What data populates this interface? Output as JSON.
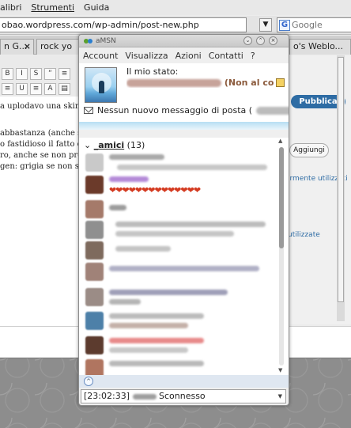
{
  "browser": {
    "menu": [
      "alibri",
      "Strumenti",
      "Guida"
    ],
    "url": "obao.wordpress.com/wp-admin/post-new.php",
    "search_placeholder": "Google",
    "tabs": [
      {
        "label": "n G..."
      },
      {
        "label": "rock yo"
      },
      {
        "label": "o's Weblo..."
      }
    ],
    "editor_text": [
      "a uplodavo una skin di",
      "",
      "abbastanza (anche se",
      "o fastidioso il fatto che l",
      "ro, anche se non premu",
      "gen: grigia se non selez"
    ],
    "publish_label": "Pubblica",
    "add_label": "Aggiungi",
    "link_often_used": "irmente utilizzati",
    "link_used": "utilizzate"
  },
  "amsn": {
    "title": "aMSN",
    "menu": [
      "Account",
      "Visualizza",
      "Azioni",
      "Contatti",
      "?"
    ],
    "my_state_label": "Il mio stato:",
    "my_state_suffix": "(Non al co",
    "mail_text": "Nessun nuovo messaggio di posta (",
    "group_label": "_amici",
    "group_count": "(13)",
    "hearts": "❤❤❤❤❤❤❤❤❤❤❤❤❤❤",
    "event_time": "[23:02:33]",
    "event_text": "Sconnesso",
    "colors": {
      "accent_blue": "#2e6ca4",
      "state_brown": "#8b5a3c",
      "separator": "#b7dff3"
    }
  }
}
